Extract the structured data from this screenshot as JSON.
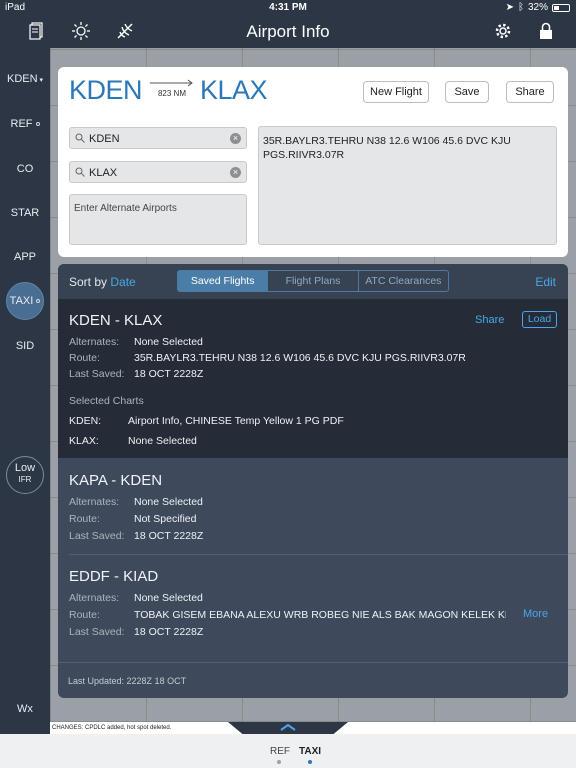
{
  "status": {
    "device": "iPad",
    "time": "4:31 PM",
    "battery": "32%"
  },
  "toolbar": {
    "title": "Airport Info"
  },
  "rail": {
    "items": [
      {
        "label": "KDEN",
        "top": 0
      },
      {
        "label": "REF"
      },
      {
        "label": "CO"
      },
      {
        "label": "STAR"
      },
      {
        "label": "APP"
      },
      {
        "label": "TAXI"
      },
      {
        "label": "SID"
      }
    ],
    "low_ifr": {
      "label": "Low",
      "sub": "IFR"
    },
    "wx": "Wx"
  },
  "route": {
    "from": "KDEN",
    "to": "KLAX",
    "distance": "823 NM",
    "buttons": {
      "new_flight": "New Flight",
      "save": "Save",
      "share": "Share"
    },
    "departure_field": "KDEN",
    "destination_field": "KLAX",
    "alternate_placeholder": "Enter Alternate Airports",
    "route_text": "35R.BAYLR3.TEHRU N38 12.6 W106 45.6 DVC KJU PGS.RIIVR3.07R"
  },
  "saved": {
    "sort_label": "Sort by",
    "sort_value": "Date",
    "tabs": [
      "Saved Flights",
      "Flight Plans",
      "ATC Clearances"
    ],
    "active_tab": 0,
    "edit": "Edit",
    "labels": {
      "alternates": "Alternates:",
      "route": "Route:",
      "last_saved": "Last Saved:",
      "selected_charts": "Selected Charts"
    },
    "flights": [
      {
        "title": "KDEN - KLAX",
        "alternates": "None Selected",
        "route": "35R.BAYLR3.TEHRU N38 12.6 W106 45.6 DVC KJU PGS.RIIVR3.07R",
        "last_saved": "18 OCT 2228Z",
        "share": "Share",
        "load": "Load",
        "charts": [
          {
            "airport": "KDEN:",
            "value": "Airport Info, CHINESE Temp Yellow 1 PG PDF"
          },
          {
            "airport": "KLAX:",
            "value": "None Selected"
          }
        ]
      },
      {
        "title": "KAPA - KDEN",
        "alternates": "None Selected",
        "route": "Not Specified",
        "last_saved": "18 OCT 2228Z"
      },
      {
        "title": "EDDF - KIAD",
        "alternates": "None Selected",
        "route": "TOBAK GISEM EBANA ALEXU WRB ROBEG NIE ALS BAK MAGON KELEK KF",
        "last_saved": "18 OCT 2228Z",
        "more": "More"
      }
    ],
    "last_updated": "Last Updated:  2228Z 18 OCT"
  },
  "chart_footer": "CHANGES:  CPDLC added, hot spot deleted.",
  "bottom_tabs": [
    "REF",
    "TAXI"
  ],
  "bottom_active": 1
}
